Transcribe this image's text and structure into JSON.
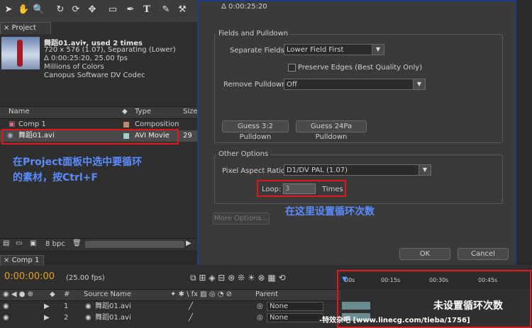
{
  "toolbar": {
    "tools": [
      "arrow",
      "hand",
      "zoom",
      "rotate",
      "camera-orbit",
      "pan-behind",
      "rect-mask",
      "pen",
      "T",
      "brush",
      "stamp"
    ]
  },
  "project": {
    "tab": "Project",
    "asset_name": "舞蹈01.avi▾, used 2 times",
    "asset_dims": "720 x 576 (1.07), Separating (Lower)",
    "asset_duration": "Δ 0:00:25:20, 25.00 fps",
    "asset_colors": "Millions of Colors",
    "asset_codec": "Canopus Software DV Codec",
    "col_name": "Name",
    "col_type": "Type",
    "col_size": "Size",
    "rows": [
      {
        "name": "Comp 1",
        "type": "Composition",
        "size": "",
        "swatch": "#b88a6a"
      },
      {
        "name": "舞蹈01.avi",
        "type": "AVI Movie",
        "size": "29",
        "swatch": "#9fcfcf"
      }
    ],
    "annotation_line1": "在Project面板中选中要循环",
    "annotation_line2": "的素材，按Ctrl+F",
    "bpc": "8 bpc"
  },
  "dialog": {
    "duration": "Δ 0:00:25:20",
    "fields_group": "Fields and Pulldown",
    "separate_fields_label": "Separate Fields:",
    "separate_fields_value": "Lower Field First",
    "preserve_edges": "Preserve Edges (Best Quality Only)",
    "remove_pulldown_label": "Remove Pulldown:",
    "remove_pulldown_value": "Off",
    "guess32": "Guess 3:2 Pulldown",
    "guess24": "Guess 24Pa Pulldown",
    "other_group": "Other Options",
    "par_label": "Pixel Aspect Ratio:",
    "par_value": "D1/DV PAL (1.07)",
    "loop_label": "Loop:",
    "loop_value": "3",
    "times": "Times",
    "more_options": "More Options...",
    "ok": "OK",
    "cancel": "Cancel",
    "annotation": "在这里设置循环次数"
  },
  "timeline": {
    "tab": "Comp 1",
    "timecode": "0:00:00:00",
    "fps": "(25.00 fps)",
    "col_hash": "#",
    "col_source": "Source Name",
    "col_parent": "Parent",
    "rows": [
      {
        "num": "1",
        "name": "舞蹈01.avi",
        "parent": "None"
      },
      {
        "num": "2",
        "name": "舞蹈01.avi",
        "parent": "None"
      }
    ],
    "ticks": [
      "00s",
      "00:15s",
      "00:30s",
      "00:45s"
    ],
    "annotation": "未设置循环次数",
    "watermark": "-特效杂吧 [www.linecg.com/tieba/1756]"
  },
  "colors": {
    "annotation_blue": "#5a8cff",
    "highlight_red": "#e01818"
  }
}
